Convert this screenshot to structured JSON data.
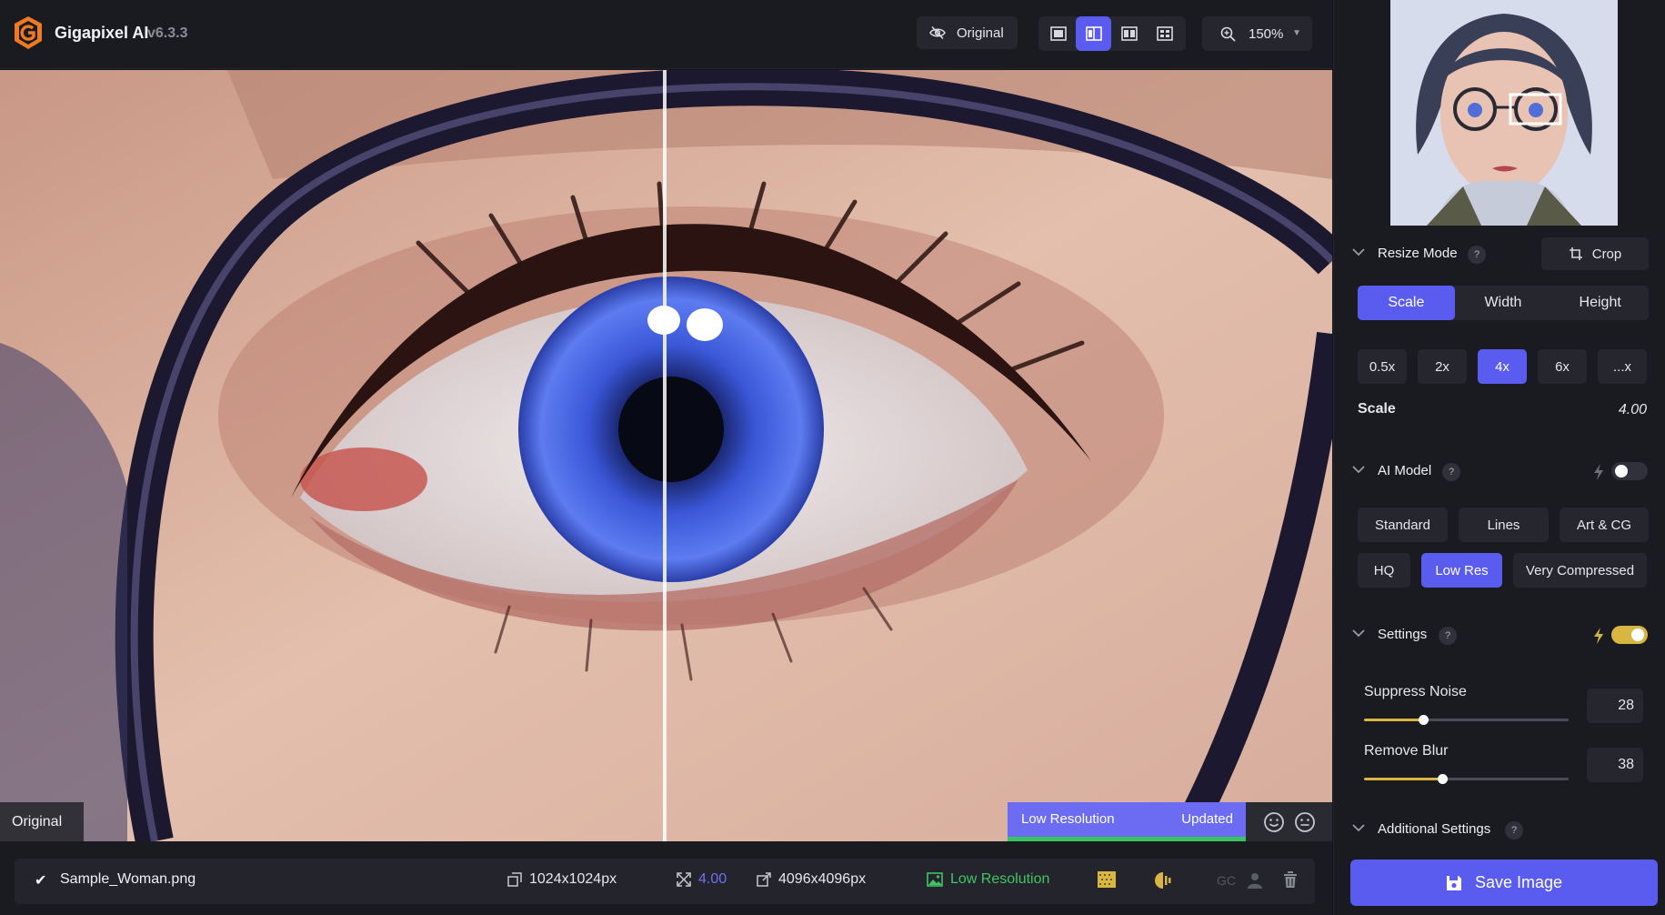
{
  "app": {
    "name": "Gigapixel AI",
    "version": "v6.3.3"
  },
  "toolbar": {
    "original_label": "Original",
    "zoom_value": "150%"
  },
  "canvas": {
    "original_tag": "Original",
    "status_left": "Low Resolution",
    "status_right": "Updated"
  },
  "file_bar": {
    "file_name": "Sample_Woman.png",
    "source_size": "1024x1024px",
    "scale": "4.00",
    "output_size": "4096x4096px",
    "model": "Low Resolution",
    "gc_label": "GC"
  },
  "resize_mode": {
    "title": "Resize Mode",
    "help": "?",
    "crop_label": "Crop",
    "tabs": [
      "Scale",
      "Width",
      "Height"
    ],
    "active_tab": "Scale",
    "presets": [
      "0.5x",
      "2x",
      "4x",
      "6x",
      "...x"
    ],
    "active_preset": "4x",
    "scale_label": "Scale",
    "scale_value": "4.00"
  },
  "ai_model": {
    "title": "AI Model",
    "help": "?",
    "row1": [
      "Standard",
      "Lines",
      "Art & CG"
    ],
    "row2": [
      "HQ",
      "Low Res",
      "Very Compressed"
    ],
    "active": "Low Res",
    "auto_enabled": false
  },
  "settings": {
    "title": "Settings",
    "help": "?",
    "auto_enabled": true,
    "suppress_noise_label": "Suppress Noise",
    "suppress_noise_value": "28",
    "remove_blur_label": "Remove Blur",
    "remove_blur_value": "38"
  },
  "additional_settings": {
    "title": "Additional Settings",
    "help": "?"
  },
  "save_label": "Save Image",
  "colors": {
    "accent": "#5a5cf0",
    "success": "#3fc464",
    "warning": "#d7b641"
  }
}
